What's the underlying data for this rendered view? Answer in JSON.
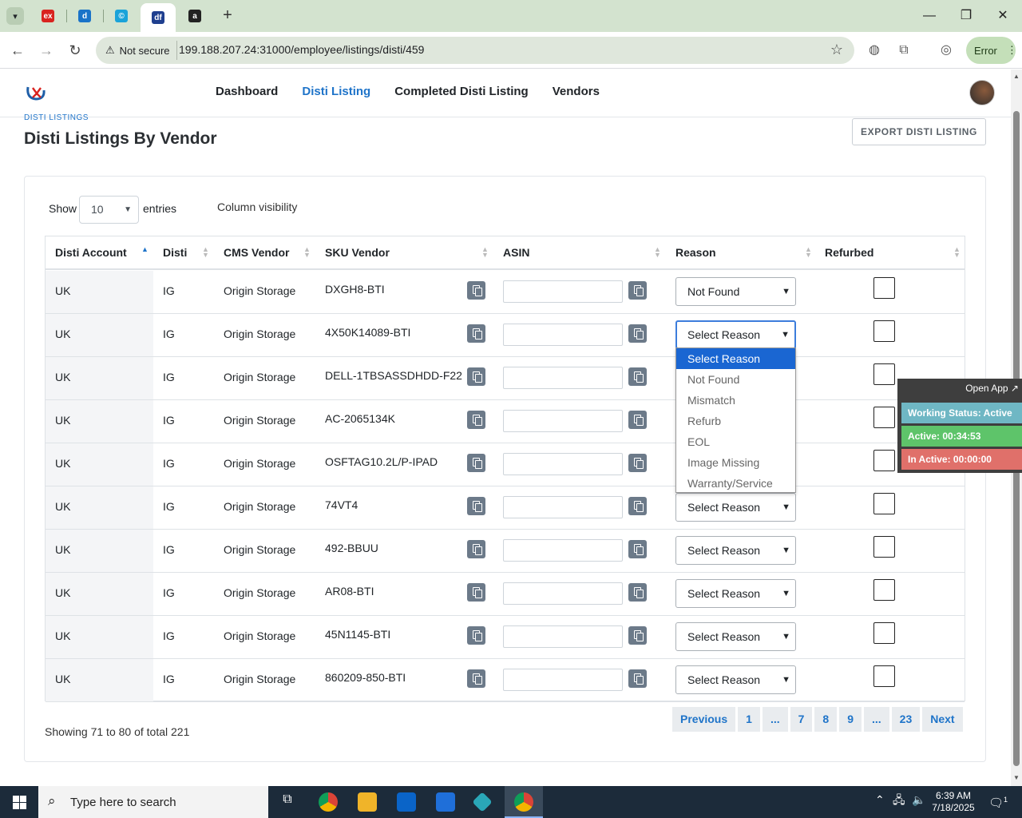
{
  "browser": {
    "tabs": [
      {
        "icon": "ex-favicon",
        "label": "ex",
        "color": "#d9231f"
      },
      {
        "icon": "d-favicon",
        "label": "d",
        "color": "#1a73c8"
      },
      {
        "icon": "c-favicon",
        "label": "©",
        "color": "#1aa3d9"
      },
      {
        "icon": "df-favicon",
        "label": "df",
        "color": "#1f3f8f"
      },
      {
        "icon": "amazon-favicon",
        "label": "a",
        "color": "#222222"
      }
    ],
    "not_secure": "Not secure",
    "url": "199.188.207.24:31000/employee/listings/disti/459",
    "error_label": "Error"
  },
  "nav": {
    "links": [
      "Dashboard",
      "Disti Listing",
      "Completed Disti Listing",
      "Vendors"
    ],
    "active_index": 1
  },
  "page": {
    "breadcrumb": "DISTI LISTINGS",
    "title": "Disti Listings By Vendor",
    "export_label": "EXPORT DISTI LISTING"
  },
  "controls": {
    "show_label": "Show",
    "entries_value": "10",
    "entries_label": "entries",
    "column_visibility": "Column visibility"
  },
  "table": {
    "headers": [
      "Disti Account",
      "Disti",
      "CMS Vendor",
      "SKU Vendor",
      "ASIN",
      "Reason",
      "Refurbed"
    ],
    "rows": [
      {
        "account": "UK",
        "disti": "IG",
        "vendor": "Origin Storage",
        "sku": "DXGH8-BTI",
        "asin": "",
        "reason": "Not Found"
      },
      {
        "account": "UK",
        "disti": "IG",
        "vendor": "Origin Storage",
        "sku": "4X50K14089-BTI",
        "asin": "",
        "reason": "Select Reason"
      },
      {
        "account": "UK",
        "disti": "IG",
        "vendor": "Origin Storage",
        "sku": "DELL-1TBSASSDHDD-F22",
        "asin": "",
        "reason": ""
      },
      {
        "account": "UK",
        "disti": "IG",
        "vendor": "Origin Storage",
        "sku": "AC-2065134K",
        "asin": "",
        "reason": ""
      },
      {
        "account": "UK",
        "disti": "IG",
        "vendor": "Origin Storage",
        "sku": "OSFTAG10.2L/P-IPAD",
        "asin": "",
        "reason": ""
      },
      {
        "account": "UK",
        "disti": "IG",
        "vendor": "Origin Storage",
        "sku": "74VT4",
        "asin": "",
        "reason": "Select Reason"
      },
      {
        "account": "UK",
        "disti": "IG",
        "vendor": "Origin Storage",
        "sku": "492-BBUU",
        "asin": "",
        "reason": "Select Reason"
      },
      {
        "account": "UK",
        "disti": "IG",
        "vendor": "Origin Storage",
        "sku": "AR08-BTI",
        "asin": "",
        "reason": "Select Reason"
      },
      {
        "account": "UK",
        "disti": "IG",
        "vendor": "Origin Storage",
        "sku": "45N1145-BTI",
        "asin": "",
        "reason": "Select Reason"
      },
      {
        "account": "UK",
        "disti": "IG",
        "vendor": "Origin Storage",
        "sku": "860209-850-BTI",
        "asin": "",
        "reason": "Select Reason"
      }
    ]
  },
  "dropdown": {
    "options": [
      "Select Reason",
      "Not Found",
      "Mismatch",
      "Refurb",
      "EOL",
      "Image Missing",
      "Warranty/Service"
    ],
    "highlighted": "Select Reason"
  },
  "pagination": {
    "summary": "Showing 71 to 80 of total 221",
    "buttons": [
      "Previous",
      "1",
      "...",
      "7",
      "8",
      "9",
      "...",
      "23",
      "Next"
    ]
  },
  "widget": {
    "open_app": "Open App ↗",
    "working_status": "Working Status: Active",
    "active": "Active: 00:34:53",
    "inactive": "In Active: 00:00:00",
    "colors": {
      "status": "#6fb7c4",
      "active": "#5ec46a",
      "inactive": "#e0706a"
    }
  },
  "taskbar": {
    "search_placeholder": "Type here to search",
    "time": "6:39 AM",
    "date": "7/18/2025",
    "notification_count": "1"
  }
}
